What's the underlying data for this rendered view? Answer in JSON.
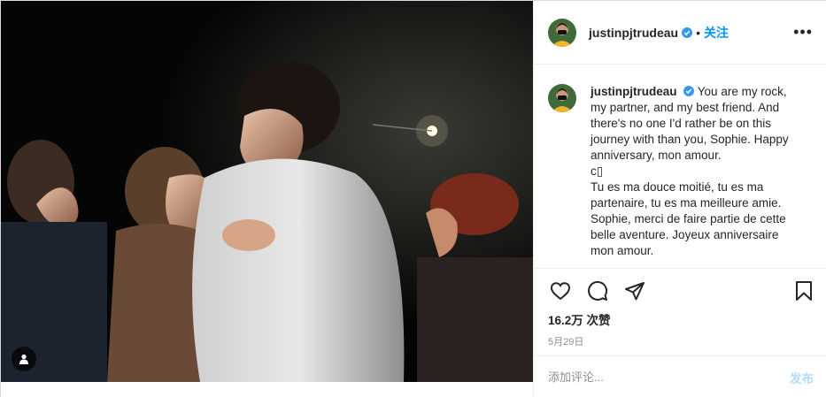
{
  "post": {
    "author": {
      "username": "justinpjtrudeau",
      "verified": true,
      "follow_label": "关注",
      "more_label": "•••"
    },
    "caption": {
      "username": "justinpjtrudeau",
      "lines": [
        "You are my rock,",
        "my partner, and my best friend. And",
        "there's no one I'd rather be on this",
        "journey with than you, Sophie. Happy",
        "anniversary, mon amour.",
        "c▯",
        "Tu es ma douce moitié, tu es ma",
        "partenaire, tu es ma meilleure amie.",
        "Sophie, merci de faire partie de cette",
        "belle aventure. Joyeux anniversaire",
        "mon amour."
      ]
    },
    "likes_text": "16.2万 次赞",
    "date_text": "5月29日",
    "comment": {
      "placeholder": "添加评论...",
      "value": "",
      "post_label": "发布"
    }
  },
  "icons": {
    "like": "heart-icon",
    "comment": "comment-icon",
    "share": "share-icon",
    "save": "bookmark-icon",
    "tagged": "user-tag-icon",
    "verified": "verified-badge-icon"
  },
  "colors": {
    "accent": "#0095f6",
    "post_disabled": "#b3dbff",
    "muted": "#8e8e8e",
    "text": "#262626",
    "border": "#efefef"
  }
}
